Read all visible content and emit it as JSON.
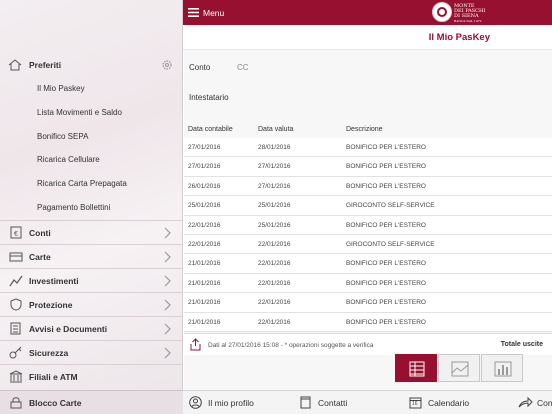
{
  "topbar": {
    "menu_label": "Menu",
    "logo_text": [
      "MONTE",
      "DEI PASCHI",
      "DI SIENA",
      "BANCA DAL 1472"
    ]
  },
  "page_title": "Il Mio PasKey",
  "sidebar": {
    "favorites_label": "Preferiti",
    "favorites": [
      "Il Mio Paskey",
      "Lista Movimenti e Saldo",
      "Bonifico SEPA",
      "Ricarica Cellulare",
      "Ricarica Carta Prepagata",
      "Pagamento Bollettini"
    ],
    "sections": [
      {
        "label": "Conti",
        "icon": "conti-icon"
      },
      {
        "label": "Carte",
        "icon": "card-icon"
      },
      {
        "label": "Investimenti",
        "icon": "chart-icon"
      },
      {
        "label": "Protezione",
        "icon": "shield-icon"
      },
      {
        "label": "Avvisi e Documenti",
        "icon": "documents-icon"
      },
      {
        "label": "Sicurezza",
        "icon": "key-icon"
      },
      {
        "label": "Filiali e ATM",
        "icon": "bank-icon"
      },
      {
        "label": "Blocco Carte",
        "icon": "lock-icon"
      }
    ]
  },
  "account": {
    "conto_label": "Conto",
    "conto_value": "CC",
    "intestatario_label": "Intestatario",
    "intestatario_value": ""
  },
  "table": {
    "headers": [
      "Data contabile",
      "Data valuta",
      "Descrizione"
    ],
    "rows": [
      [
        "27/01/2016",
        "28/01/2016",
        "BONIFICO PER L'ESTERO"
      ],
      [
        "27/01/2016",
        "27/01/2016",
        "BONIFICO PER L'ESTERO"
      ],
      [
        "26/01/2016",
        "27/01/2016",
        "BONIFICO PER L'ESTERO"
      ],
      [
        "25/01/2016",
        "25/01/2016",
        "GIROCONTO SELF-SERVICE"
      ],
      [
        "22/01/2016",
        "25/01/2016",
        "BONIFICO PER L'ESTERO"
      ],
      [
        "22/01/2016",
        "22/01/2016",
        "GIROCONTO SELF-SERVICE"
      ],
      [
        "21/01/2016",
        "22/01/2016",
        "BONIFICO PER L'ESTERO"
      ],
      [
        "21/01/2016",
        "22/01/2016",
        "BONIFICO PER L'ESTERO"
      ],
      [
        "21/01/2016",
        "22/01/2016",
        "BONIFICO PER L'ESTERO"
      ],
      [
        "21/01/2016",
        "22/01/2016",
        "BONIFICO PER L'ESTERO"
      ]
    ]
  },
  "footer": {
    "note": "Dati al 27/01/2016 15:08 - * operazioni soggette a verifica",
    "total_label": "Totale uscite"
  },
  "bottom_nav": [
    {
      "label": "Il mio profilo",
      "icon": "profile-icon"
    },
    {
      "label": "Contatti",
      "icon": "contacts-icon"
    },
    {
      "label": "Calendario",
      "icon": "calendar-icon",
      "badge": "16"
    },
    {
      "label": "Con",
      "icon": "share-icon"
    }
  ],
  "colors": {
    "brand": "#97102f"
  }
}
